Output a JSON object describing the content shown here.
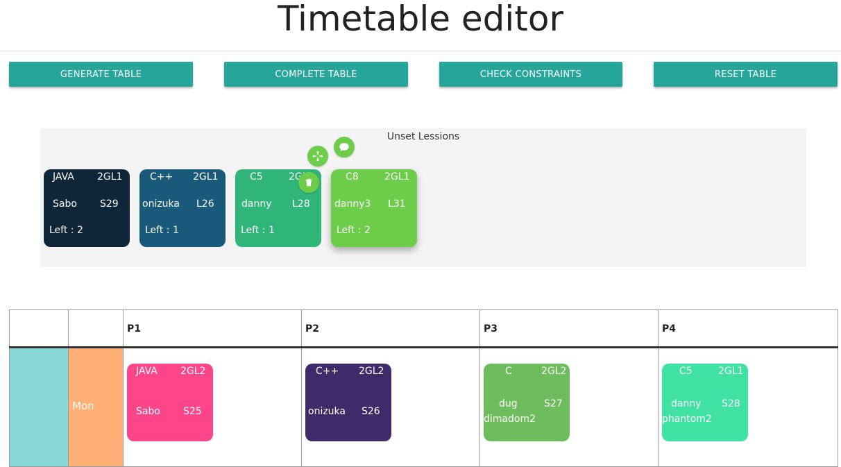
{
  "page": {
    "title": "Timetable editor"
  },
  "toolbar": {
    "generate": "GENERATE TABLE",
    "complete": "COMPLETE TABLE",
    "check": "CHECK CONSTRAINTS",
    "reset": "RESET TABLE"
  },
  "unset": {
    "title": "Unset Lessions",
    "cards": [
      {
        "subject": "JAVA",
        "group": "2GL1",
        "teacher": "Sabo",
        "room": "S29",
        "left": "Left : 2",
        "color": "#0f2538"
      },
      {
        "subject": "C++",
        "group": "2GL1",
        "teacher": "onizuka",
        "room": "L26",
        "left": "Left : 1",
        "color": "#195a7b"
      },
      {
        "subject": "C5",
        "group": "2GL1",
        "teacher": "danny",
        "room": "L28",
        "left": "Left : 1",
        "color": "#30b578"
      },
      {
        "subject": "C8",
        "group": "2GL1",
        "teacher": "danny3",
        "room": "L31",
        "left": "Left : 2",
        "color": "#6dcd4a"
      }
    ],
    "actions": [
      "move-icon",
      "comment-icon",
      "trash-icon"
    ]
  },
  "table": {
    "headers": [
      "",
      "",
      "P1",
      "P2",
      "P3",
      "P4"
    ],
    "rows": [
      {
        "day": "Mon",
        "cells": [
          {
            "subject": "JAVA",
            "group": "2GL2",
            "teacher": "Sabo",
            "room": "S25",
            "extra": "",
            "color": "#fc4689"
          },
          {
            "subject": "C++",
            "group": "2GL2",
            "teacher": "onizuka",
            "room": "S26",
            "extra": "",
            "color": "#3f2a6a"
          },
          {
            "subject": "C",
            "group": "2GL2",
            "teacher": "dug",
            "room": "S27",
            "extra": "dimadom2",
            "color": "#6dbd5c"
          },
          {
            "subject": "C5",
            "group": "2GL1",
            "teacher": "danny",
            "room": "S28",
            "extra": "phantom2",
            "color": "#3fe2a3"
          }
        ]
      }
    ]
  },
  "colors": {
    "accent": "#26a69a",
    "day_color": "#89d9d9",
    "day_name": "#ffb076"
  }
}
